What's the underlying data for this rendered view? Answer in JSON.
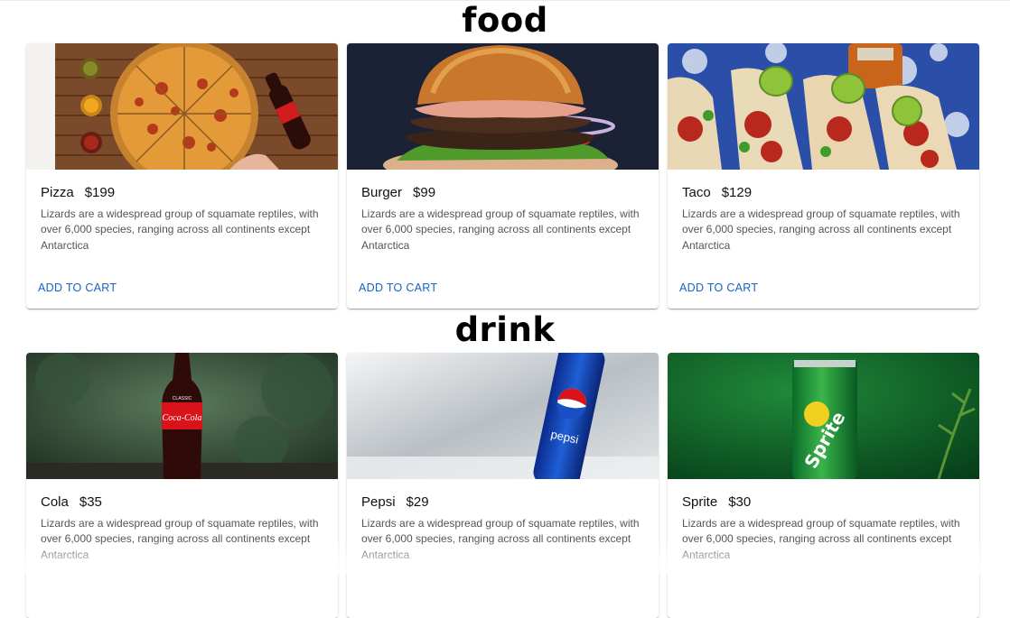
{
  "sections": [
    {
      "title": "food",
      "items": [
        {
          "name": "Pizza",
          "price": "$199",
          "description": "Lizards are a widespread group of squamate reptiles, with over 6,000 species, ranging across all continents except Antarctica",
          "action": "ADD TO CART"
        },
        {
          "name": "Burger",
          "price": "$99",
          "description": "Lizards are a widespread group of squamate reptiles, with over 6,000 species, ranging across all continents except Antarctica",
          "action": "ADD TO CART"
        },
        {
          "name": "Taco",
          "price": "$129",
          "description": "Lizards are a widespread group of squamate reptiles, with over 6,000 species, ranging across all continents except Antarctica",
          "action": "ADD TO CART"
        }
      ]
    },
    {
      "title": "drink",
      "items": [
        {
          "name": "Cola",
          "price": "$35",
          "description": "Lizards are a widespread group of squamate reptiles, with over 6,000 species, ranging across all continents except Antarctica"
        },
        {
          "name": "Pepsi",
          "price": "$29",
          "description": "Lizards are a widespread group of squamate reptiles, with over 6,000 species, ranging across all continents except Antarctica"
        },
        {
          "name": "Sprite",
          "price": "$30",
          "description": "Lizards are a widespread group of squamate reptiles, with over 6,000 species, ranging across all continents except Antarctica"
        }
      ]
    }
  ],
  "image_labels": {
    "cola_logo": "Coca-Cola",
    "cola_small": "CLASSIC",
    "pepsi": "pepsi",
    "sprite": "Sprite"
  }
}
